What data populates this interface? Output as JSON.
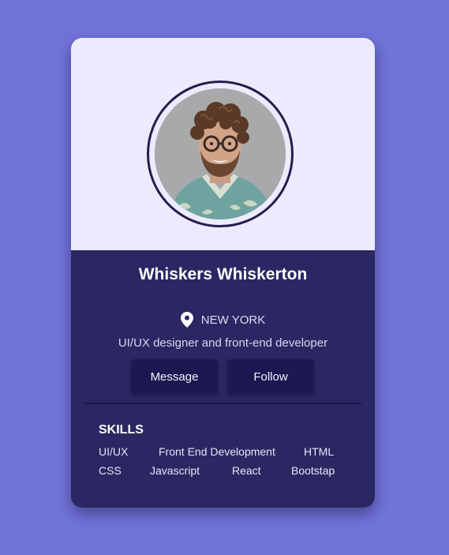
{
  "profile": {
    "name": "Whiskers Whiskerton",
    "location": "NEW YORK",
    "bio": "UI/UX designer and front-end developer",
    "avatar_icon": "profile-photo"
  },
  "actions": {
    "message_label": "Message",
    "follow_label": "Follow"
  },
  "skills": {
    "title": "SKILLS",
    "items": [
      "UI/UX",
      "Front End Development",
      "HTML",
      "CSS",
      "Javascript",
      "React",
      "Bootstap"
    ]
  },
  "colors": {
    "page_background": "#7173d9",
    "card_background": "#2b2762",
    "card_header": "#ecebfd",
    "button_background": "#1d1851"
  }
}
